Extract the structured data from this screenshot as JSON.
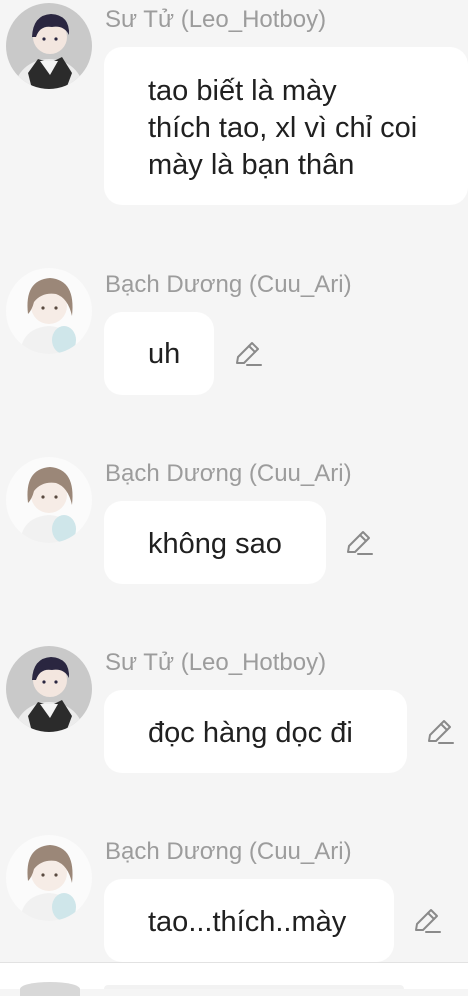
{
  "messages": [
    {
      "sender": "Sư Tử (Leo_Hotboy)",
      "avatar": "leo-avatar",
      "lines": [
        "tao biết là mày",
        "thích tao, xl vì chỉ coi",
        "mày là bạn thân"
      ],
      "editable": false
    },
    {
      "sender": "Bạch Dương (Cuu_Ari)",
      "avatar": "ari-avatar",
      "lines": [
        "uh"
      ],
      "editable": true,
      "edit_icon": "pencil-icon"
    },
    {
      "sender": "Bạch Dương (Cuu_Ari)",
      "avatar": "ari-avatar",
      "lines": [
        "không sao"
      ],
      "editable": true,
      "edit_icon": "pencil-icon"
    },
    {
      "sender": "Sư Tử (Leo_Hotboy)",
      "avatar": "leo-avatar",
      "lines": [
        "đọc hàng dọc đi"
      ],
      "editable": true,
      "edit_icon": "pencil-icon"
    },
    {
      "sender": "Bạch Dương (Cuu_Ari)",
      "avatar": "ari-avatar",
      "lines": [
        "tao...thích..mày"
      ],
      "editable": true,
      "edit_icon": "pencil-icon"
    }
  ],
  "colors": {
    "background": "#f5f5f5",
    "bubble": "#ffffff",
    "sender_text": "#9c9c9c",
    "message_text": "#202020"
  }
}
